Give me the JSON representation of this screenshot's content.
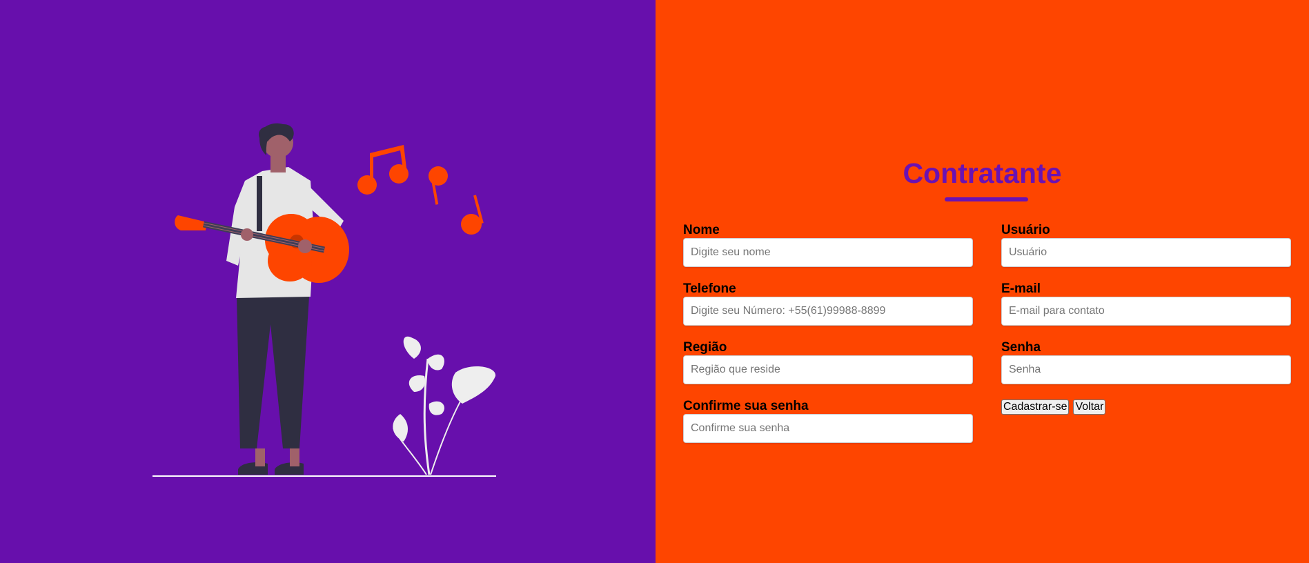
{
  "form": {
    "title": "Contratante",
    "fields": [
      {
        "label": "Nome",
        "placeholder": "Digite seu nome"
      },
      {
        "label": "Usuário",
        "placeholder": "Usuário"
      },
      {
        "label": "Telefone",
        "placeholder": "Digite seu Número: +55(61)99988-8899"
      },
      {
        "label": "E-mail",
        "placeholder": "E-mail para contato"
      },
      {
        "label": "Região",
        "placeholder": "Região que reside"
      },
      {
        "label": "Senha",
        "placeholder": "Senha"
      },
      {
        "label": "Confirme sua senha",
        "placeholder": "Confirme sua senha"
      }
    ],
    "submit_label": "Cadastrar-se",
    "back_label": "Voltar"
  },
  "colors": {
    "left_background": "#670fac",
    "right_background": "#fe4500",
    "title": "#6a12b3",
    "illustration_accent": "#fe4500"
  },
  "illustration": {
    "icons": [
      "guitarist-illustration",
      "music-notes-icon",
      "plant-icon"
    ]
  }
}
